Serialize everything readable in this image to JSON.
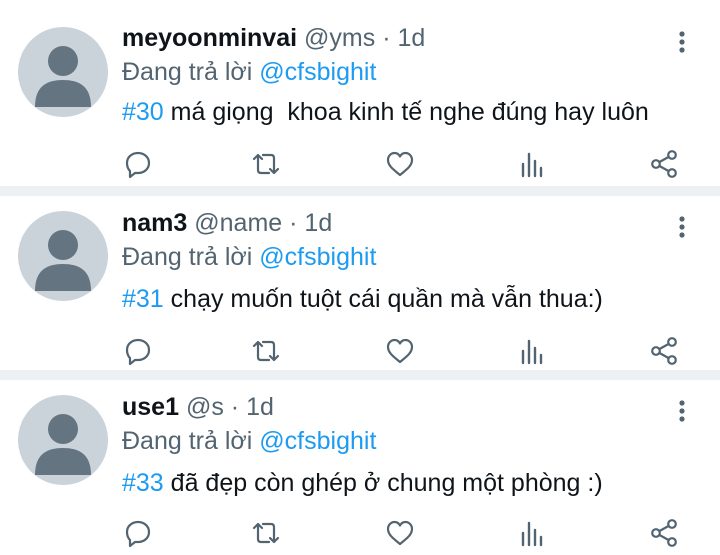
{
  "tweets": [
    {
      "name": "meyoonminvai",
      "handle": "@yms",
      "sep": "·",
      "time": "1d",
      "reply_prefix": "Đang trả lời",
      "reply_to": "@cfsbighit",
      "hashtag": "#30",
      "text": " má giọng  khoa kinh tế nghe đúng hay luôn"
    },
    {
      "name": "nam3",
      "handle": "@name",
      "sep": "·",
      "time": "1d",
      "reply_prefix": "Đang trả lời",
      "reply_to": "@cfsbighit",
      "hashtag": "#31",
      "text": " chạy muốn tuột cái quần mà vẫn thua:)"
    },
    {
      "name": "use1",
      "handle": "@s",
      "sep": "·",
      "time": "1d",
      "reply_prefix": "Đang trả lời",
      "reply_to": "@cfsbighit",
      "hashtag": "#33",
      "text": " đã đẹp còn ghép ở chung một phòng :)"
    }
  ],
  "icons": {
    "reply": "comment-icon",
    "retweet": "retweet-icon",
    "like": "heart-icon",
    "views": "analytics-icon",
    "share": "share-icon",
    "more": "more-vertical-icon"
  },
  "colors": {
    "link": "#1d9bf0",
    "text": "#0f1419",
    "muted": "#536471",
    "avatar_bg": "#cbd3da",
    "avatar_fg": "#647481",
    "divider": "#eef1f4"
  }
}
